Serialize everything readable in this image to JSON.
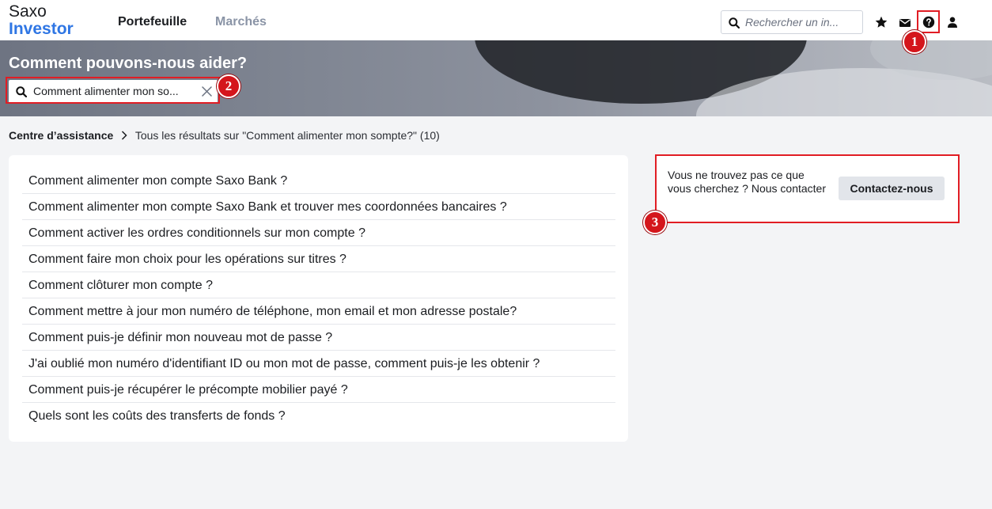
{
  "header": {
    "logo_line1": "Saxo",
    "logo_line2": "Investor",
    "nav": {
      "portfolio": "Portefeuille",
      "markets": "Marchés"
    },
    "search_placeholder": "Rechercher un in...",
    "icons": [
      "star-icon",
      "mail-icon",
      "help-icon",
      "user-icon"
    ]
  },
  "hero": {
    "title": "Comment pouvons-nous aider?",
    "search_value": "Comment alimenter mon so..."
  },
  "breadcrumb": {
    "root": "Centre d’assistance",
    "current": "Tous les résultats sur \"Comment alimenter mon sompte?\" (10)"
  },
  "results": [
    "Comment alimenter mon compte Saxo Bank ?",
    "Comment alimenter mon compte Saxo Bank et trouver mes coordonnées bancaires ?",
    "Comment activer les ordres conditionnels sur mon compte ?",
    "Comment faire mon choix pour les opérations sur titres ?",
    "Comment clôturer mon compte ?",
    "Comment mettre à jour mon numéro de téléphone, mon email et mon adresse postale?",
    "Comment puis-je définir mon nouveau mot de passe ?",
    "J'ai oublié mon numéro d'identifiant ID ou mon mot de passe, comment puis-je les obtenir ?",
    "Comment puis-je récupérer le précompte mobilier payé ?",
    "Quels sont les coûts des transferts de fonds ?"
  ],
  "contact": {
    "text": "Vous ne trouvez pas ce que vous cherchez ? Nous contacter",
    "button": "Contactez-nous"
  },
  "annotations": {
    "badge1": "1",
    "badge2": "2",
    "badge3": "3"
  },
  "colors": {
    "brand_blue": "#2f76e4",
    "annotation_red": "#e11d24"
  }
}
